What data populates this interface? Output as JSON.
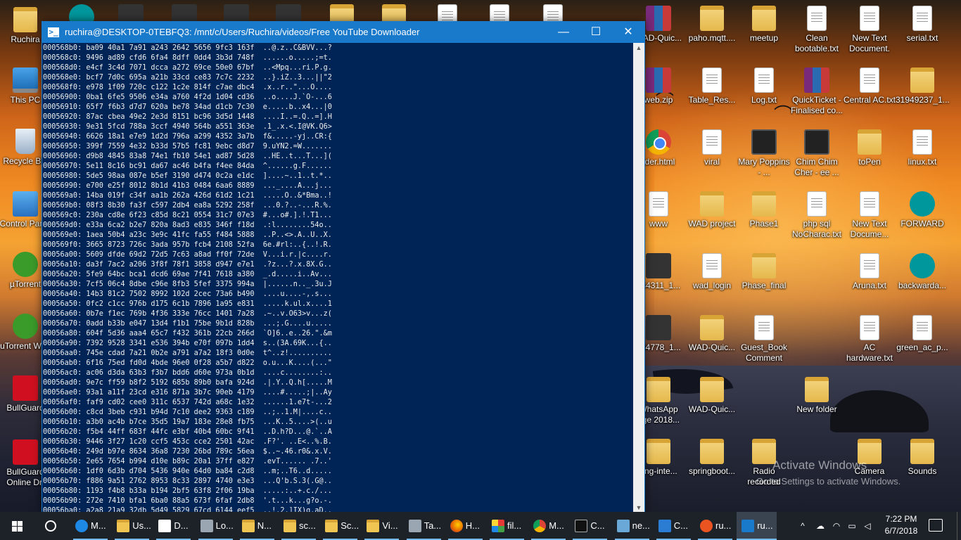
{
  "terminal": {
    "title": "ruchira@DESKTOP-0TEBFQ3: /mnt/c/Users/Ruchira/videos/Free YouTube Downloader",
    "icon_label": ">_",
    "controls": {
      "minimize": "—",
      "maximize": "☐",
      "close": "✕"
    },
    "scroll_up": "▲",
    "scroll_down": "▼",
    "lines": [
      "000568b0: ba09 40a1 7a91 a243 2642 5656 9fc3 163f  ..@.z..C&BVV...?",
      "000568c0: 9496 ad89 cfd6 6fa4 8dff 0dd4 3b3d 748f  ......o.....;=t.",
      "000568d0: e4cf 3c4d 7071 dcca a272 69ce 50e0 67bf  ..<Mpq...ri.P.g.",
      "000568e0: bcf7 7d0c 695a a21b 33cd ce83 7c7c 2232  ..}.iZ..3...||\"2",
      "000568f0: e978 1f09 720c c122 1c2e 814f c7ae dbc4  .x..r..\"...O....",
      "00056900: 0ba1 6fe5 9506 e34a a760 4f2d 1d04 cd36  ..o....J.`O-...6",
      "00056910: 65f7 f6b3 d7d7 620a be78 34ad d1cb 7c30  e.....b..x4...|0",
      "00056920: 87ac cbea 49e2 2e3d 8151 bc96 3d5d 1448  ....I..=.Q..=].H",
      "00056930: 9e31 5fcd 788a 3ccf 4940 564b a551 363e  .1_.x.<.I@VK.Q6>",
      "00056940: 6626 18a1 e7e9 1d2d 796a a299 4352 3a7b  f&.....-yj..CR:{",
      "00056950: 399f 7559 4e32 b33d 57b5 fc81 9ebc d8d7  9.uYN2.=W.......",
      "00056960: d9b8 4845 83a8 74e1 fb10 54e1 ad87 5d28  ..HE..t...T...](",
      "00056970: 5e11 8c16 bc91 da67 ac46 b4fa f4ee 84da  ^......g.F......",
      "00056980: 5de5 98aa 087e b5ef 3190 d474 0c2a e1dc  ]....~..1..t.*..",
      "00056990: e700 e25f 8012 8b1d 41b3 0484 6aa6 8889  ..._....A...j...",
      "000569a0: 14ba 019f c34f aa1b 262a 426d 61d2 1c21  .....O..&*Bma..!",
      "000569b0: 08f3 8b30 fa3f c597 2db4 ea8a 5292 258f  ...0.?..-...R.%.",
      "000569c0: 230a cd8e 6f23 c85d 8c21 0554 31c7 07e3  #...o#.].!.T1...",
      "000569d0: e33a 6ca2 b2e7 820a 8ad3 e835 346f f18d  .:l........54o..",
      "000569e0: 1aea 50b4 a23c 3e9c 41fc fa55 f484 5888  ..P..<>.A..U..X.",
      "000569f0: 3665 8723 726c 3ada 957b fcb4 2108 52fa  6e.#rl:..{..!.R.",
      "00056a00: 5609 dfde 69d2 72d5 7c63 a8ad ff0f 72de  V...i.r.|c....r.",
      "00056a10: da3f 7ac2 a206 3f8f 78f1 3858 d947 e7e1  .?z...?.x.8X.G..",
      "00056a20: 5fe9 64bc bca1 dcd6 69ae 7f41 7618 a380  _.d.....i..Av...",
      "00056a30: 7cf5 06c4 8dbe c96e 8fb3 5fef 3375 994a  |......n.._.3u.J",
      "00056a40: 14b3 81c2 7502 8992 102d 2cec 73a6 b490  ....u....-,.s...",
      "00056a50: 0fc2 c1cc 976b d175 6c1b 7896 1a95 e831  .....k.ul.x....1",
      "00056a60: 0b7e f1ec 769b 4f36 333e 76cc 1401 7a28  .~..v.O63>v...z(",
      "00056a70: 0add b33b e047 13d4 f1b1 75be 9b1d 828b  ...;.G....u.....",
      "00056a80: 604f 5d36 aaa4 65c7 f432 361b 22cb 266d  `O]6..e..26.\".&m",
      "00056a90: 7392 9528 3341 e536 394b e70f 097b 1dd4  s..(3A.69K...{..",
      "00056aa0: 745e cdad 7a21 0b2e a791 a7a2 18f3 0d0e  t^..z!..........",
      "00056ab0: 6f16 75ed fd0d 4bde 96e0 0f28 a5b7 d822  o.u...K....(...\"",
      "00056ac0: ac06 d3da 63b3 f3b7 bdd6 d60e 973a 0b1d  ....c........:..",
      "00056ad0: 9e7c ff59 b8f2 5192 685b 89b0 bafa 924d  .|.Y..Q.h[.....M",
      "00056ae0: 93a1 a11f 23cd e316 871a 3b7c 90eb 4179  ....#.....;|..Ay",
      "00056af0: faf9 cd02 cee0 311c 6537 742d a68c 1e32  ......1.e7t-...2",
      "00056b00: c8cd 3beb c931 b94d 7c10 dee2 9363 c189  ..;..1.M|....c..",
      "00056b10: a3b0 ac4b b7ce 35d5 19a7 183e 28e8 fb75  ...K..5....>(..u",
      "00056b20: f5b4 44ff 683f 44fc e3bf 40b4 60bc 9f41  ..D.h?D...@.`..A",
      "00056b30: 9446 3f27 1c20 ccf5 453c cce2 2501 42ac  .F?'. ..E<..%.B.",
      "00056b40: 249d b97e 8634 36a8 7230 26bd 789c 56ea  $..~.46.r0&.x.V.",
      "00056b50: 2e65 7654 b994 d10e b89c 20a1 37ff e827  .evT...... .7..'",
      "00056b60: 1df0 6d3b d704 5436 940e 64d0 ba84 c2d8  ..m;..T6..d.....",
      "00056b70: f886 9a51 2762 8953 8c33 2897 4740 e3e3  ...Q'b.S.3(.G@..",
      "00056b80: 1193 f4b8 b33a b194 2bf5 63f8 2f06 19ba  .....:..+.c./...",
      "00056b90: 272e 7410 bfa1 6ba0 88a5 673f 6faf 2db8  '.t...k...g?o.-.",
      "00056ba0: a2a8 21a9 32db 5d49 5829 67cd 6144 eef5  ..!.2.]IX)g.aD.."
    ]
  },
  "desktop_left": [
    {
      "label": "Ruchira",
      "icon": "user-folder-icon"
    },
    {
      "label": "This PC",
      "icon": "this-pc-icon"
    },
    {
      "label": "Recycle Bin",
      "icon": "recycle-bin-icon"
    },
    {
      "label": "Control Panel",
      "icon": "control-panel-icon"
    },
    {
      "label": "µTorrent",
      "icon": "utorrent-icon"
    },
    {
      "label": "uTorrent Web",
      "icon": "utorrent-web-icon"
    },
    {
      "label": "BullGuard",
      "icon": "bullguard-icon"
    },
    {
      "label": "BullGuard Online Dri",
      "icon": "bullguard-online-icon"
    }
  ],
  "desktop_top_partial": [
    {
      "icon": "arduino-icon"
    },
    {
      "icon": "dvd-icon"
    },
    {
      "icon": "audio-icon"
    },
    {
      "icon": "satellite-icon"
    },
    {
      "icon": "app-icon"
    },
    {
      "icon": "folder-icon"
    },
    {
      "icon": "image-icon"
    },
    {
      "icon": "doc-icon"
    },
    {
      "icon": "file-icon"
    },
    {
      "icon": "file-icon"
    }
  ],
  "desktop_right": [
    {
      "label": "WAD-Quic...",
      "icon": "rar-icon",
      "col": 0,
      "row": 0
    },
    {
      "label": "paho.mqtt....",
      "icon": "folder-icon",
      "col": 1,
      "row": 0
    },
    {
      "label": "meetup",
      "icon": "folder-icon",
      "col": 2,
      "row": 0
    },
    {
      "label": "Clean bootable.txt",
      "icon": "text-file-icon",
      "col": 3,
      "row": 0
    },
    {
      "label": "New Text Document.",
      "icon": "text-file-icon",
      "col": 4,
      "row": 0
    },
    {
      "label": "serial.txt",
      "icon": "text-file-icon",
      "col": 5,
      "row": 0
    },
    {
      "label": "web.zip",
      "icon": "rar-icon",
      "col": 0,
      "row": 1
    },
    {
      "label": "Table_Res...",
      "icon": "chrome-doc-icon",
      "col": 1,
      "row": 1
    },
    {
      "label": "Log.txt",
      "icon": "text-file-icon",
      "col": 2,
      "row": 1
    },
    {
      "label": "QuickTicket - Finalised co...",
      "icon": "rar-icon",
      "col": 3,
      "row": 1
    },
    {
      "label": "Central AC.txt",
      "icon": "text-file-icon",
      "col": 4,
      "row": 1
    },
    {
      "label": "31949237_1...",
      "icon": "image-icon",
      "col": 5,
      "row": 1
    },
    {
      "label": "rder.html",
      "icon": "chrome-icon",
      "col": 0,
      "row": 2
    },
    {
      "label": "viral",
      "icon": "chrome-doc-icon",
      "col": 1,
      "row": 2
    },
    {
      "label": "Mary Poppins - ...",
      "icon": "video-icon",
      "col": 2,
      "row": 2
    },
    {
      "label": "Chim Chim Cher - ee ...",
      "icon": "video-icon",
      "col": 3,
      "row": 2
    },
    {
      "label": "toPen",
      "icon": "folder-icon",
      "col": 4,
      "row": 2
    },
    {
      "label": "linux.txt",
      "icon": "text-file-icon",
      "col": 5,
      "row": 2
    },
    {
      "label": "www",
      "icon": "chrome-doc-icon",
      "col": 0,
      "row": 3
    },
    {
      "label": "WAD project",
      "icon": "folder-icon",
      "col": 1,
      "row": 3
    },
    {
      "label": "Phase1",
      "icon": "folder-icon",
      "col": 2,
      "row": 3
    },
    {
      "label": "php sql NoCharac.txt",
      "icon": "text-file-icon",
      "col": 3,
      "row": 3
    },
    {
      "label": "New Text Docume...",
      "icon": "text-file-icon",
      "col": 4,
      "row": 3
    },
    {
      "label": "FORWARD",
      "icon": "arduino-icon",
      "col": 5,
      "row": 3
    },
    {
      "label": "484311_1...",
      "icon": "phone-icon",
      "col": 0,
      "row": 4
    },
    {
      "label": "wad_login",
      "icon": "chrome-doc-icon",
      "col": 1,
      "row": 4
    },
    {
      "label": "Phase_final",
      "icon": "folder-icon",
      "col": 2,
      "row": 4
    },
    {
      "label": "Aruna.txt",
      "icon": "text-file-icon",
      "col": 4,
      "row": 4
    },
    {
      "label": "backwarda...",
      "icon": "arduino-icon",
      "col": 5,
      "row": 4
    },
    {
      "label": "484778_1...",
      "icon": "phone-icon",
      "col": 0,
      "row": 5
    },
    {
      "label": "WAD-Quic...",
      "icon": "folder-icon",
      "col": 1,
      "row": 5
    },
    {
      "label": "Guest_Book Comment",
      "icon": "chrome-doc-icon",
      "col": 2,
      "row": 5
    },
    {
      "label": "AC hardware.txt",
      "icon": "text-file-icon",
      "col": 4,
      "row": 5
    },
    {
      "label": "green_ac_p...",
      "icon": "text-file-icon",
      "col": 5,
      "row": 5
    },
    {
      "label": "WhatsApp age 2018...",
      "icon": "image-icon",
      "col": 0,
      "row": 6
    },
    {
      "label": "WAD-Quic...",
      "icon": "folder-icon",
      "col": 1,
      "row": 6
    },
    {
      "label": "New folder",
      "icon": "folder-icon",
      "col": 3,
      "row": 6
    },
    {
      "label": "ring-inte...",
      "icon": "folder-icon",
      "col": 0,
      "row": 7
    },
    {
      "label": "springboot...",
      "icon": "folder-icon",
      "col": 1,
      "row": 7
    },
    {
      "label": "Radio recorded",
      "icon": "folder-icon",
      "col": 2,
      "row": 7
    },
    {
      "label": "Camera",
      "icon": "folder-icon",
      "col": 4,
      "row": 7
    },
    {
      "label": "Sounds",
      "icon": "folder-icon",
      "col": 5,
      "row": 7
    }
  ],
  "watermark": {
    "line1": "Activate Windows",
    "line2": "Go to Settings to activate Windows."
  },
  "taskbar": {
    "items": [
      {
        "label": "M...",
        "icon": "edge-icon",
        "state": "open"
      },
      {
        "label": "Us...",
        "icon": "folder-icon",
        "state": "open"
      },
      {
        "label": "D...",
        "icon": "document-icon",
        "state": "open"
      },
      {
        "label": "Lo...",
        "icon": "network-icon",
        "state": "open"
      },
      {
        "label": "N...",
        "icon": "folder-icon",
        "state": "open"
      },
      {
        "label": "sc...",
        "icon": "folder-icon",
        "state": "open"
      },
      {
        "label": "Sc...",
        "icon": "folder-icon",
        "state": "open"
      },
      {
        "label": "Vi...",
        "icon": "folder-icon",
        "state": "open"
      },
      {
        "label": "Ta...",
        "icon": "task-manager-icon",
        "state": "open"
      },
      {
        "label": "H...",
        "icon": "firefox-icon",
        "state": "open"
      },
      {
        "label": "fil...",
        "icon": "grid-app-icon",
        "state": "open"
      },
      {
        "label": "M...",
        "icon": "chrome-icon",
        "state": "open"
      },
      {
        "label": "C...",
        "icon": "cmd-icon",
        "state": "open"
      },
      {
        "label": "ne...",
        "icon": "notepad-icon",
        "state": "open"
      },
      {
        "label": "C...",
        "icon": "app-window-icon",
        "state": "open"
      },
      {
        "label": "ru...",
        "icon": "ubuntu-icon",
        "state": "open"
      },
      {
        "label": "ru...",
        "icon": "powershell-icon",
        "state": "active"
      }
    ],
    "tray": {
      "chevron": "^",
      "clock_time": "7:22 PM",
      "clock_date": "6/7/2018"
    }
  }
}
